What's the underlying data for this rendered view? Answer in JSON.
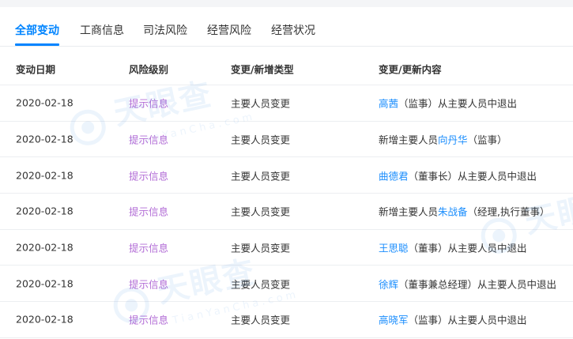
{
  "tabs": [
    {
      "label": "全部变动",
      "active": true
    },
    {
      "label": "工商信息",
      "active": false
    },
    {
      "label": "司法风险",
      "active": false
    },
    {
      "label": "经营风险",
      "active": false
    },
    {
      "label": "经营状况",
      "active": false
    }
  ],
  "table": {
    "headers": {
      "date": "变动日期",
      "level": "风险级别",
      "type": "变更/新增类型",
      "content": "变更/更新内容"
    },
    "rows": [
      {
        "date": "2020-02-18",
        "level": "提示信息",
        "type": "主要人员变更",
        "pre": "",
        "person": "高茜",
        "post": "（监事）从主要人员中退出"
      },
      {
        "date": "2020-02-18",
        "level": "提示信息",
        "type": "主要人员变更",
        "pre": "新增主要人员",
        "person": "向丹华",
        "post": "（监事）"
      },
      {
        "date": "2020-02-18",
        "level": "提示信息",
        "type": "主要人员变更",
        "pre": "",
        "person": "曲德君",
        "post": "（董事长）从主要人员中退出"
      },
      {
        "date": "2020-02-18",
        "level": "提示信息",
        "type": "主要人员变更",
        "pre": "新增主要人员",
        "person": "朱战备",
        "post": "（经理,执行董事）"
      },
      {
        "date": "2020-02-18",
        "level": "提示信息",
        "type": "主要人员变更",
        "pre": "",
        "person": "王思聪",
        "post": "（董事）从主要人员中退出"
      },
      {
        "date": "2020-02-18",
        "level": "提示信息",
        "type": "主要人员变更",
        "pre": "",
        "person": "徐辉",
        "post": "（董事兼总经理）从主要人员中退出"
      },
      {
        "date": "2020-02-18",
        "level": "提示信息",
        "type": "主要人员变更",
        "pre": "",
        "person": "高晓军",
        "post": "（监事）从主要人员中退出"
      }
    ]
  },
  "watermark": {
    "brand": "天眼查",
    "domain": "TianYanCha.com"
  },
  "colors": {
    "accent": "#0084ff",
    "level": "#b26cd6",
    "link": "#1a8dfd"
  }
}
